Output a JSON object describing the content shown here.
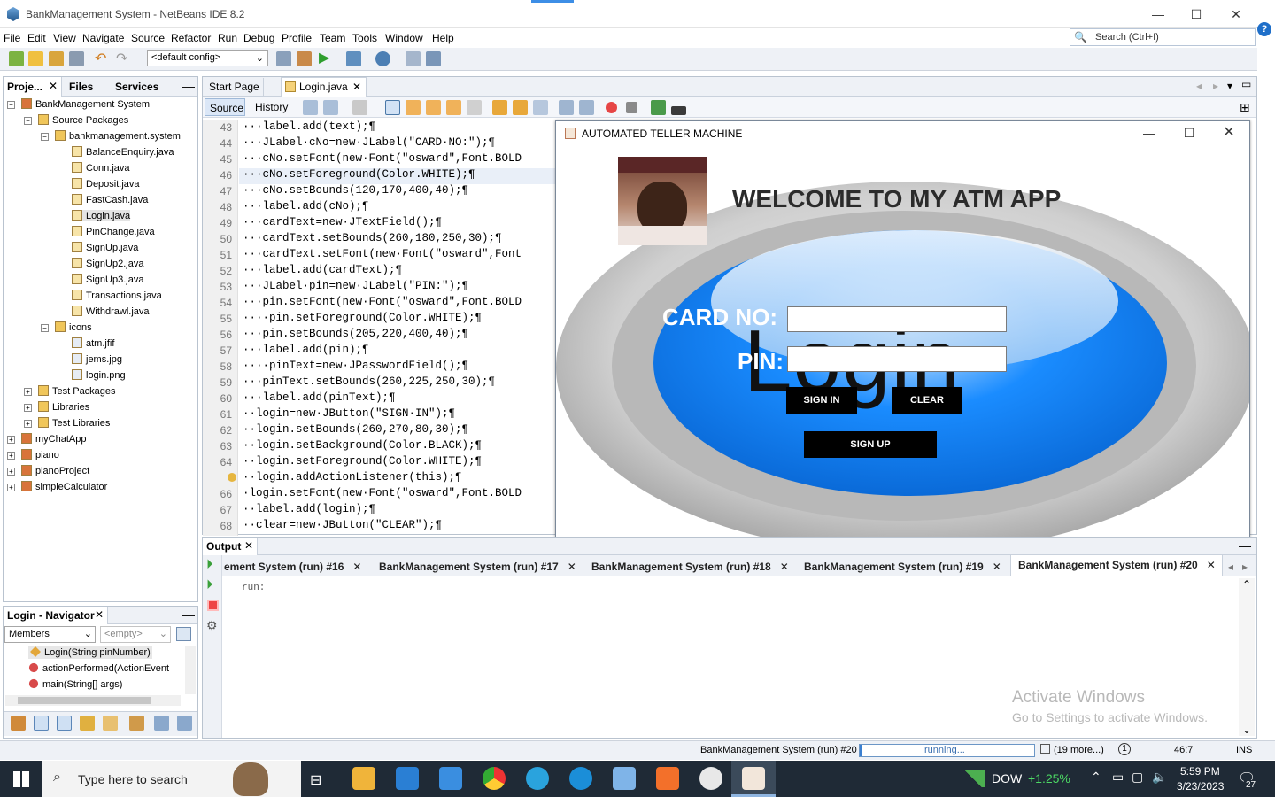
{
  "window": {
    "title": "BankManagement System - NetBeans IDE 8.2"
  },
  "menu": [
    "File",
    "Edit",
    "View",
    "Navigate",
    "Source",
    "Refactor",
    "Run",
    "Debug",
    "Profile",
    "Team",
    "Tools",
    "Window",
    "Help"
  ],
  "search": {
    "placeholder": "Search (Ctrl+I)"
  },
  "toolbar": {
    "config": "<default config>"
  },
  "projects": {
    "tabs": [
      "Proje...",
      "Files",
      "Services"
    ],
    "tree": [
      {
        "label": "BankManagement System",
        "depth": 0,
        "kind": "project"
      },
      {
        "label": "Source Packages",
        "depth": 1,
        "kind": "folder"
      },
      {
        "label": "bankmanagement.system",
        "depth": 2,
        "kind": "package"
      },
      {
        "label": "BalanceEnquiry.java",
        "depth": 3,
        "kind": "java"
      },
      {
        "label": "Conn.java",
        "depth": 3,
        "kind": "java"
      },
      {
        "label": "Deposit.java",
        "depth": 3,
        "kind": "java"
      },
      {
        "label": "FastCash.java",
        "depth": 3,
        "kind": "java"
      },
      {
        "label": "Login.java",
        "depth": 3,
        "kind": "java"
      },
      {
        "label": "PinChange.java",
        "depth": 3,
        "kind": "java"
      },
      {
        "label": "SignUp.java",
        "depth": 3,
        "kind": "java"
      },
      {
        "label": "SignUp2.java",
        "depth": 3,
        "kind": "java"
      },
      {
        "label": "SignUp3.java",
        "depth": 3,
        "kind": "java"
      },
      {
        "label": "Transactions.java",
        "depth": 3,
        "kind": "java"
      },
      {
        "label": "Withdrawl.java",
        "depth": 3,
        "kind": "java"
      },
      {
        "label": "icons",
        "depth": 2,
        "kind": "package"
      },
      {
        "label": "atm.jfif",
        "depth": 3,
        "kind": "file"
      },
      {
        "label": "jems.jpg",
        "depth": 3,
        "kind": "file"
      },
      {
        "label": "login.png",
        "depth": 3,
        "kind": "file"
      },
      {
        "label": "Test Packages",
        "depth": 1,
        "kind": "folder"
      },
      {
        "label": "Libraries",
        "depth": 1,
        "kind": "folder"
      },
      {
        "label": "Test Libraries",
        "depth": 1,
        "kind": "folder"
      },
      {
        "label": "myChatApp",
        "depth": 0,
        "kind": "project"
      },
      {
        "label": "piano",
        "depth": 0,
        "kind": "project"
      },
      {
        "label": "pianoProject",
        "depth": 0,
        "kind": "project"
      },
      {
        "label": "simpleCalculator",
        "depth": 0,
        "kind": "project"
      }
    ]
  },
  "navigator": {
    "title": "Login - Navigator",
    "filter": "Members",
    "empty": "<empty>",
    "items": [
      "Login(String pinNumber)",
      "actionPerformed(ActionEvent",
      "main(String[] args)"
    ]
  },
  "editor": {
    "tabs": [
      "Start Page",
      "Login.java"
    ],
    "modes": [
      "Source",
      "History"
    ],
    "lines": [
      {
        "n": "43",
        "t": "···label.add(text);¶"
      },
      {
        "n": "44",
        "t": "···JLabel·cNo=new·JLabel(\"CARD·NO:\");¶"
      },
      {
        "n": "45",
        "t": "···cNo.setFont(new·Font(\"osward\",Font.BOLD"
      },
      {
        "n": "46",
        "t": "···cNo.setForeground(Color.WHITE);¶"
      },
      {
        "n": "47",
        "t": "···cNo.setBounds(120,170,400,40);¶"
      },
      {
        "n": "48",
        "t": "···label.add(cNo);¶"
      },
      {
        "n": "49",
        "t": "···cardText=new·JTextField();¶"
      },
      {
        "n": "50",
        "t": "···cardText.setBounds(260,180,250,30);¶"
      },
      {
        "n": "51",
        "t": "···cardText.setFont(new·Font(\"osward\",Font"
      },
      {
        "n": "52",
        "t": "···label.add(cardText);¶"
      },
      {
        "n": "53",
        "t": "···JLabel·pin=new·JLabel(\"PIN:\");¶"
      },
      {
        "n": "54",
        "t": "···pin.setFont(new·Font(\"osward\",Font.BOLD"
      },
      {
        "n": "55",
        "t": "····pin.setForeground(Color.WHITE);¶"
      },
      {
        "n": "56",
        "t": "···pin.setBounds(205,220,400,40);¶"
      },
      {
        "n": "57",
        "t": "···label.add(pin);¶"
      },
      {
        "n": "58",
        "t": "····pinText=new·JPasswordField();¶"
      },
      {
        "n": "59",
        "t": "···pinText.setBounds(260,225,250,30);¶"
      },
      {
        "n": "60",
        "t": "···label.add(pinText);¶"
      },
      {
        "n": "61",
        "t": "··login=new·JButton(\"SIGN·IN\");¶"
      },
      {
        "n": "62",
        "t": "··login.setBounds(260,270,80,30);¶"
      },
      {
        "n": "63",
        "t": "··login.setBackground(Color.BLACK);¶"
      },
      {
        "n": "64",
        "t": "··login.setForeground(Color.WHITE);¶"
      },
      {
        "n": "",
        "t": "··login.addActionListener(this);¶"
      },
      {
        "n": "66",
        "t": "·login.setFont(new·Font(\"osward\",Font.BOLD"
      },
      {
        "n": "67",
        "t": "··label.add(login);¶"
      },
      {
        "n": "68",
        "t": "··clear=new·JButton(\"CLEAR\");¶"
      }
    ]
  },
  "atm": {
    "title": "AUTOMATED TELLER MACHINE",
    "welcome": "WELCOME TO MY ATM APP",
    "logo_text": "Login",
    "card_label": "CARD NO:",
    "pin_label": "PIN:",
    "signin": "SIGN IN",
    "clear": "CLEAR",
    "signup": "SIGN UP"
  },
  "output": {
    "title": "Output",
    "tabs": [
      "ement System (run) #16",
      "BankManagement System (run) #17",
      "BankManagement System (run) #18",
      "BankManagement System (run) #19",
      "BankManagement System (run) #20"
    ],
    "text": "run:",
    "watermark_title": "Activate Windows",
    "watermark_sub": "Go to Settings to activate Windows."
  },
  "status": {
    "task": "BankManagement System (run) #20",
    "progress": "running...",
    "more": "(19 more...)",
    "notif": "1",
    "pos": "46:7",
    "mode": "INS"
  },
  "taskbar": {
    "search": "Type here to search",
    "stock": "DOW",
    "change": "+1.25%",
    "time": "5:59 PM",
    "date": "3/23/2023",
    "badge": "27"
  }
}
